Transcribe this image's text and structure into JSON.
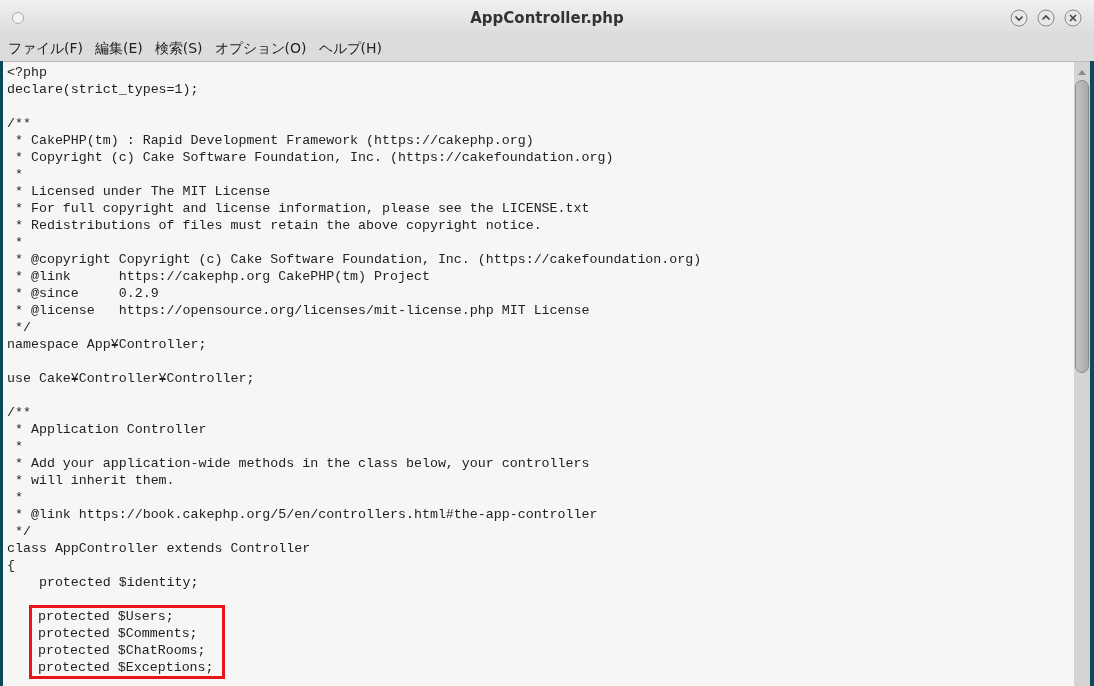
{
  "window": {
    "title": "AppController.php"
  },
  "menu": [
    "ファイル(F)",
    "編集(E)",
    "検索(S)",
    "オプション(O)",
    "ヘルプ(H)"
  ],
  "code": {
    "blocks": [
      {
        "highlighted": false,
        "lines": [
          "<?php",
          "declare(strict_types=1);"
        ]
      },
      {
        "highlighted": false,
        "lines": [
          "/**",
          " * CakePHP(tm) : Rapid Development Framework (https://cakephp.org)",
          " * Copyright (c) Cake Software Foundation, Inc. (https://cakefoundation.org)",
          " *",
          " * Licensed under The MIT License",
          " * For full copyright and license information, please see the LICENSE.txt",
          " * Redistributions of files must retain the above copyright notice.",
          " *",
          " * @copyright Copyright (c) Cake Software Foundation, Inc. (https://cakefoundation.org)",
          " * @link      https://cakephp.org CakePHP(tm) Project",
          " * @since     0.2.9",
          " * @license   https://opensource.org/licenses/mit-license.php MIT License",
          " */",
          "namespace App¥Controller;"
        ]
      },
      {
        "highlighted": false,
        "lines": [
          "use Cake¥Controller¥Controller;"
        ]
      },
      {
        "highlighted": false,
        "lines": [
          "/**",
          " * Application Controller",
          " *",
          " * Add your application-wide methods in the class below, your controllers",
          " * will inherit them.",
          " *",
          " * @link https://book.cakephp.org/5/en/controllers.html#the-app-controller",
          " */",
          "class AppController extends Controller",
          "{",
          "    protected $identity;"
        ]
      },
      {
        "highlighted": true,
        "lines": [
          "    protected $Users;",
          "    protected $Comments;",
          "    protected $ChatRooms;",
          "    protected $Exceptions;"
        ]
      }
    ]
  }
}
